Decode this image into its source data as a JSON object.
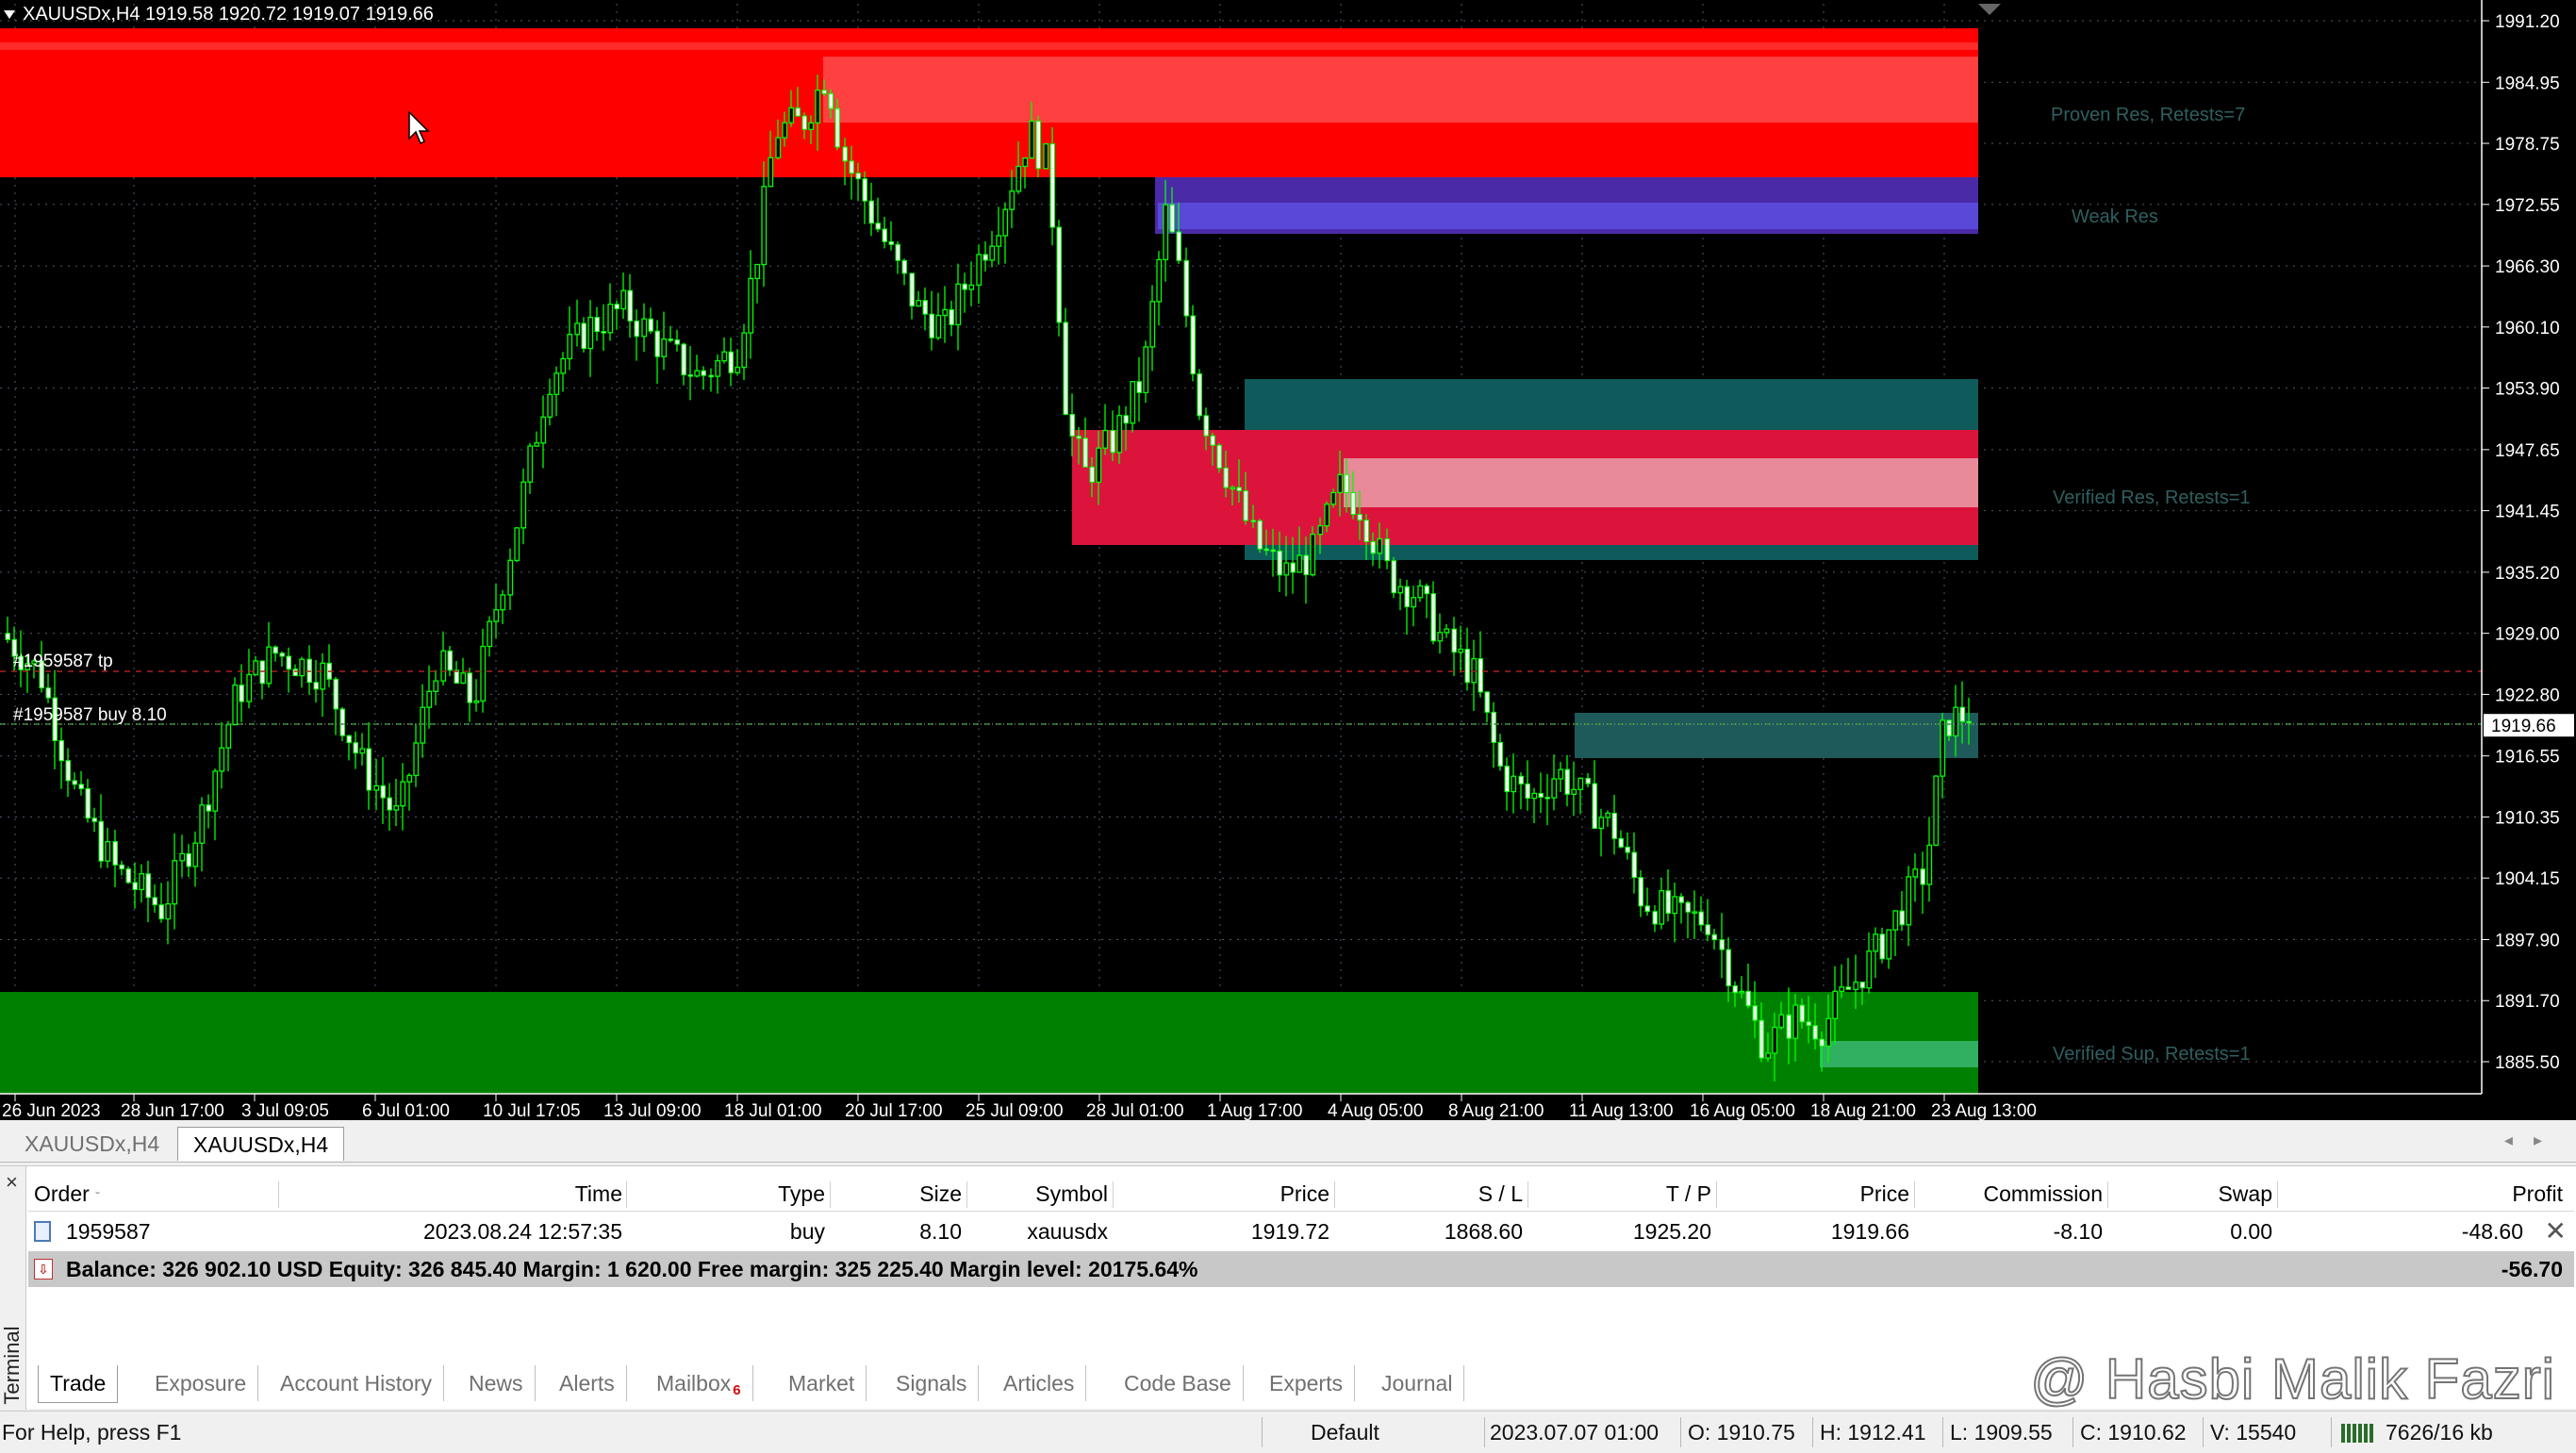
{
  "chart": {
    "header": "XAUUSDx,H4  1919.58 1920.72 1919.07 1919.66",
    "price_labels": [
      "1991.20",
      "1984.95",
      "1978.75",
      "1972.55",
      "1966.30",
      "1960.10",
      "1953.90",
      "1947.65",
      "1941.45",
      "1935.20",
      "1929.00",
      "1922.80",
      "1916.55",
      "1910.35",
      "1904.15",
      "1897.90",
      "1891.70",
      "1885.50"
    ],
    "current_price": "1919.66",
    "time_labels": [
      "26 Jun 2023",
      "28 Jun 17:00",
      "3 Jul 09:05",
      "6 Jul 01:00",
      "10 Jul 17:05",
      "13 Jul 09:00",
      "18 Jul 01:00",
      "20 Jul 17:00",
      "25 Jul 09:00",
      "28 Jul 01:00",
      "1 Aug 17:00",
      "4 Aug 05:00",
      "8 Aug 21:00",
      "11 Aug 13:00",
      "16 Aug 05:00",
      "18 Aug 21:00",
      "23 Aug 13:00"
    ],
    "order_tp_label": "#1959587 tp",
    "order_buy_label": "#1959587 buy 8.10",
    "zones": [
      {
        "label": "Proven Res, Retests=7",
        "color": "#ff0000"
      },
      {
        "label": "Weak Res",
        "color": "#4b2aa8"
      },
      {
        "label": "Verified Res, Retests=1",
        "color": "#dc143c"
      },
      {
        "label": "Verified Sup, Retests=1",
        "color": "#008000"
      }
    ],
    "candle_color": "#00ff00",
    "background": "#000000"
  },
  "chart_tabs": [
    "XAUUSDx,H4",
    "XAUUSDx,H4"
  ],
  "terminal": {
    "side_label": "Terminal",
    "close_icon": "×",
    "columns": [
      "Order",
      "Time",
      "Type",
      "Size",
      "Symbol",
      "Price",
      "S / L",
      "T / P",
      "Price",
      "Commission",
      "Swap",
      "Profit"
    ],
    "sort_marker": "ˇ",
    "rows": [
      {
        "order": "1959587",
        "time": "2023.08.24 12:57:35",
        "type": "buy",
        "size": "8.10",
        "symbol": "xauusdx",
        "price": "1919.72",
        "sl": "1868.60",
        "tp": "1925.20",
        "price2": "1919.66",
        "commission": "-8.10",
        "swap": "0.00",
        "profit": "-48.60"
      }
    ],
    "balance_line": "Balance: 326 902.10 USD  Equity: 326 845.40  Margin: 1 620.00  Free margin: 325 225.40  Margin level: 20175.64%",
    "balance_total": "-56.70",
    "tabs": [
      "Trade",
      "Exposure",
      "Account History",
      "News",
      "Alerts",
      "Mailbox",
      "Market",
      "Signals",
      "Articles",
      "Code Base",
      "Experts",
      "Journal"
    ],
    "mailbox_badge": "6"
  },
  "status": {
    "help": "For Help, press F1",
    "profile": "Default",
    "datetime": "2023.07.07 01:00",
    "open": "O: 1910.75",
    "high": "H: 1912.41",
    "low": "L: 1909.55",
    "close": "C: 1910.62",
    "volume": "V: 15540",
    "traffic": "7626/16 kb"
  },
  "watermark": "@ Hasbi Malik Fazri"
}
